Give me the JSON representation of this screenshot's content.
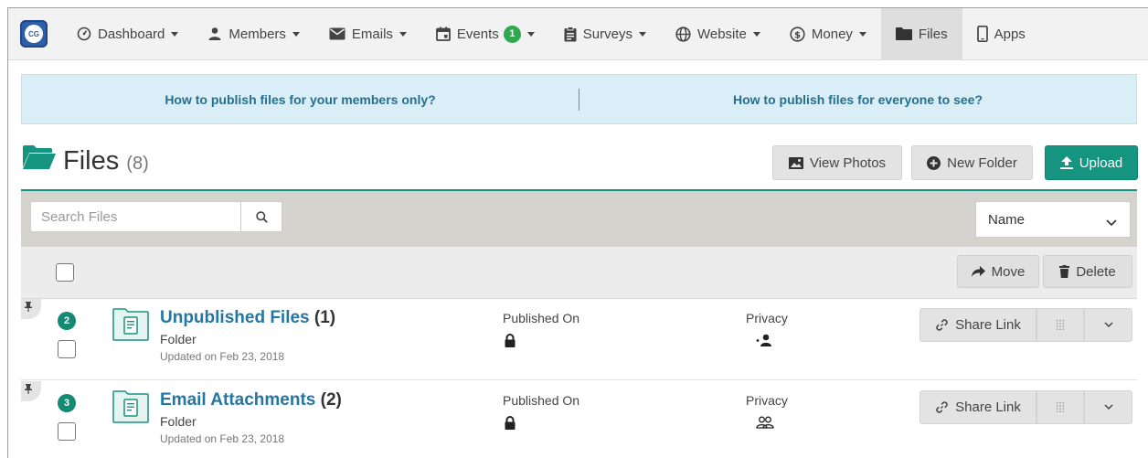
{
  "nav": {
    "logo_text": "CG",
    "items": [
      {
        "label": "Dashboard",
        "icon": "dashboard-icon",
        "caret": true
      },
      {
        "label": "Members",
        "icon": "person-icon",
        "caret": true
      },
      {
        "label": "Emails",
        "icon": "envelope-icon",
        "caret": true
      },
      {
        "label": "Events",
        "icon": "calendar-icon",
        "caret": true,
        "badge": "1"
      },
      {
        "label": "Surveys",
        "icon": "clipboard-icon",
        "caret": true
      },
      {
        "label": "Website",
        "icon": "globe-icon",
        "caret": true
      },
      {
        "label": "Money",
        "icon": "coin-icon",
        "caret": true
      },
      {
        "label": "Files",
        "icon": "folder-icon",
        "caret": false,
        "active": true
      },
      {
        "label": "Apps",
        "icon": "mobile-icon",
        "caret": false
      }
    ]
  },
  "info": {
    "left_link": "How to publish files for your members only?",
    "right_link": "How to publish files for everyone to see?"
  },
  "header": {
    "title": "Files",
    "count": "(8)",
    "view_photos": "View Photos",
    "new_folder": "New Folder",
    "upload": "Upload"
  },
  "search": {
    "placeholder": "Search Files",
    "sort_value": "Name"
  },
  "actions": {
    "move": "Move",
    "delete": "Delete"
  },
  "rows": [
    {
      "number": "2",
      "name": "Unpublished Files",
      "count": "(1)",
      "type": "Folder",
      "updated": "Updated on Feb 23, 2018",
      "published_label": "Published On",
      "privacy_label": "Privacy",
      "privacy_icon": "members-only-icon",
      "share": "Share Link"
    },
    {
      "number": "3",
      "name": "Email Attachments",
      "count": "(2)",
      "type": "Folder",
      "updated": "Updated on Feb 23, 2018",
      "published_label": "Published On",
      "privacy_label": "Privacy",
      "privacy_icon": "group-icon",
      "share": "Share Link"
    }
  ],
  "colors": {
    "teal": "#15947f",
    "link": "#2476a3",
    "info_bg": "#d9eef7",
    "badge_green": "#2fa84f"
  }
}
